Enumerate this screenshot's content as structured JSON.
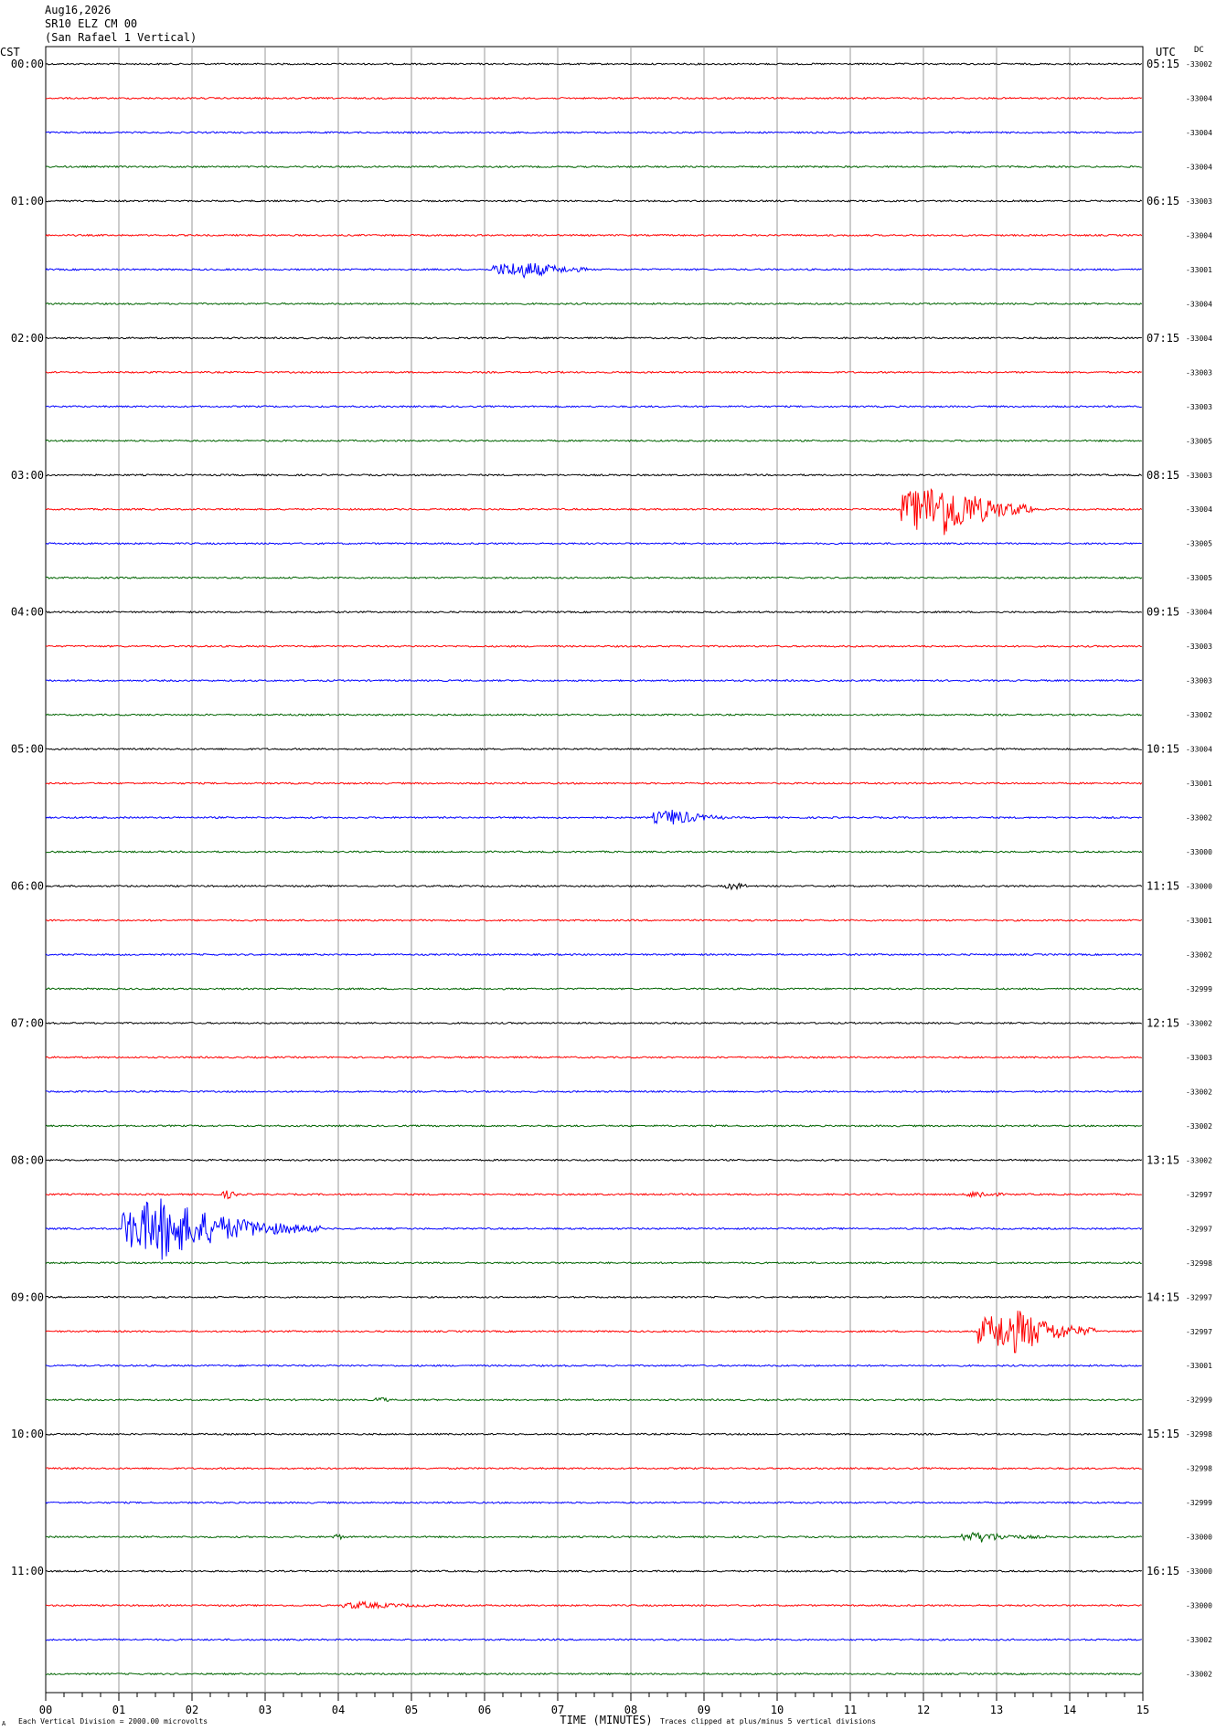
{
  "header": {
    "date": "Aug16,2026",
    "station": "SR10 ELZ CM 00",
    "location": "(San Rafael 1 Vertical)"
  },
  "labels": {
    "left_tz": "CST",
    "right_tz": "UTC",
    "dc": "DC",
    "footer_left": "Each Vertical Division = 2000.00 microvolts",
    "footer_right": "Traces clipped at plus/minus 5 vertical divisions",
    "footer_mark": "A"
  },
  "chart_data": {
    "type": "line",
    "title": "",
    "xlabel": "TIME (MINUTES)",
    "ylabel": "",
    "xlim": [
      0,
      15
    ],
    "x_ticks": [
      "00",
      "01",
      "02",
      "03",
      "04",
      "05",
      "06",
      "07",
      "08",
      "09",
      "10",
      "11",
      "12",
      "13",
      "14",
      "15"
    ],
    "grid": true,
    "trace_colors": [
      "#000000",
      "#ff0000",
      "#0000ff",
      "#006400"
    ],
    "hour_labels_local": [
      "00:00",
      "01:00",
      "02:00",
      "03:00",
      "04:00",
      "05:00",
      "06:00",
      "07:00",
      "08:00",
      "09:00",
      "10:00",
      "11:00"
    ],
    "hour_labels_utc": [
      "05:15",
      "06:15",
      "07:15",
      "08:15",
      "09:15",
      "10:15",
      "11:15",
      "12:15",
      "13:15",
      "14:15",
      "15:15",
      "16:15"
    ],
    "dc_offsets": [
      "-33002",
      "-33004",
      "-33004",
      "-33004",
      "-33003",
      "-33004",
      "-33001",
      "-33004",
      "-33004",
      "-33003",
      "-33003",
      "-33005",
      "-33003",
      "-33004",
      "-33005",
      "-33005",
      "-33004",
      "-33003",
      "-33003",
      "-33002",
      "-33004",
      "-33001",
      "-33002",
      "-33000",
      "-33000",
      "-33001",
      "-33002",
      "-32999",
      "-33002",
      "-33003",
      "-33002",
      "-33002",
      "-33002",
      "-32997",
      "-32997",
      "-32998",
      "-32997",
      "-32997",
      "-33001",
      "-32999",
      "-32998",
      "-32998",
      "-32999",
      "-33000",
      "-33000",
      "-33000",
      "-33002",
      "-33002"
    ],
    "events": [
      {
        "trace": 6,
        "start_min": 6.1,
        "peak_min": 6.6,
        "duration_min": 1.3,
        "amplitude": 0.25
      },
      {
        "trace": 13,
        "start_min": 11.7,
        "peak_min": 12.3,
        "duration_min": 1.8,
        "amplitude": 0.9
      },
      {
        "trace": 22,
        "start_min": 8.3,
        "peak_min": 8.6,
        "duration_min": 1.0,
        "amplitude": 0.25
      },
      {
        "trace": 24,
        "start_min": 9.3,
        "peak_min": 9.45,
        "duration_min": 0.3,
        "amplitude": 0.1
      },
      {
        "trace": 34,
        "start_min": 1.05,
        "peak_min": 1.6,
        "duration_min": 2.7,
        "amplitude": 1.0
      },
      {
        "trace": 33,
        "start_min": 2.4,
        "peak_min": 2.5,
        "duration_min": 0.3,
        "amplitude": 0.12
      },
      {
        "trace": 33,
        "start_min": 12.6,
        "peak_min": 12.8,
        "duration_min": 0.5,
        "amplitude": 0.1
      },
      {
        "trace": 37,
        "start_min": 12.75,
        "peak_min": 13.3,
        "duration_min": 1.6,
        "amplitude": 0.7
      },
      {
        "trace": 39,
        "start_min": 4.5,
        "peak_min": 4.6,
        "duration_min": 0.2,
        "amplitude": 0.08
      },
      {
        "trace": 43,
        "start_min": 12.5,
        "peak_min": 12.8,
        "duration_min": 1.2,
        "amplitude": 0.15
      },
      {
        "trace": 43,
        "start_min": 3.9,
        "peak_min": 4.0,
        "duration_min": 0.2,
        "amplitude": 0.08
      },
      {
        "trace": 45,
        "start_min": 4.05,
        "peak_min": 4.3,
        "duration_min": 1.5,
        "amplitude": 0.1
      }
    ]
  }
}
